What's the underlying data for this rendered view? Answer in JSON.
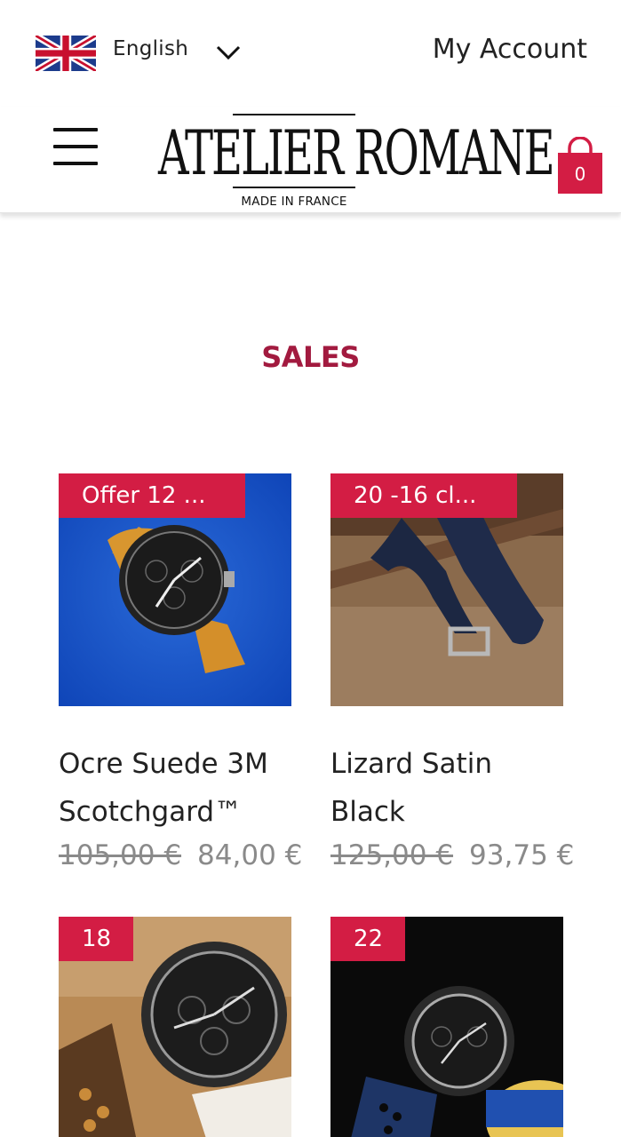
{
  "language": {
    "label": "English",
    "flag_icon": "uk-flag-icon"
  },
  "account": {
    "label": "My Account"
  },
  "brand": {
    "name": "ATELIER ROMANE",
    "tagline": "MADE IN FRANCE"
  },
  "cart": {
    "count": "0"
  },
  "section": {
    "title": "SALES"
  },
  "products": [
    {
      "badge": "Offer 12 ...",
      "name": "Ocre Suede 3M Scotchgard™",
      "old_price": "105,00 €",
      "price": "84,00 €"
    },
    {
      "badge": "20 -16 cl...",
      "name": "Lizard Satin Black",
      "old_price": "125,00 €",
      "price": "93,75 €"
    },
    {
      "badge": "18"
    },
    {
      "badge": "22"
    }
  ],
  "colors": {
    "accent": "#d31d44",
    "title": "#a21a3f"
  }
}
